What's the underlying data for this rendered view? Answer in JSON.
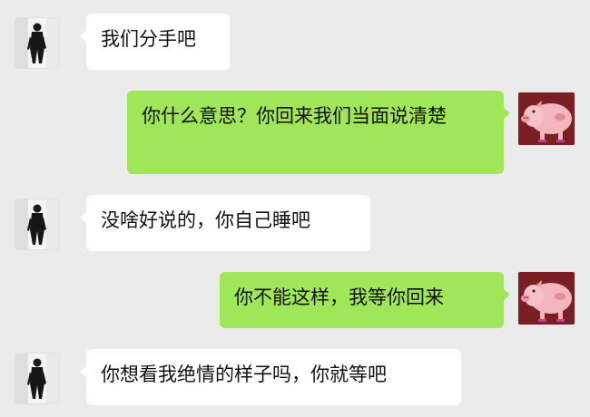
{
  "messages": [
    {
      "side": "in",
      "text": "我们分手吧",
      "avatar": "man-photo-avatar"
    },
    {
      "side": "out",
      "text": "你什么意思？你回来我们当面说清楚",
      "avatar": "pig-cartoon-avatar"
    },
    {
      "side": "in",
      "text": "没啥好说的，你自己睡吧",
      "avatar": "man-photo-avatar"
    },
    {
      "side": "out",
      "text": "你不能这样，我等你回来",
      "avatar": "pig-cartoon-avatar"
    },
    {
      "side": "in",
      "text": "你想看我绝情的样子吗，你就等吧",
      "avatar": "man-photo-avatar"
    }
  ],
  "colors": {
    "background": "#ebebeb",
    "incoming_bubble": "#ffffff",
    "outgoing_bubble": "#9fe658",
    "pig_avatar_bg": "#7a1f24",
    "pig_body": "#f4b6bd"
  }
}
